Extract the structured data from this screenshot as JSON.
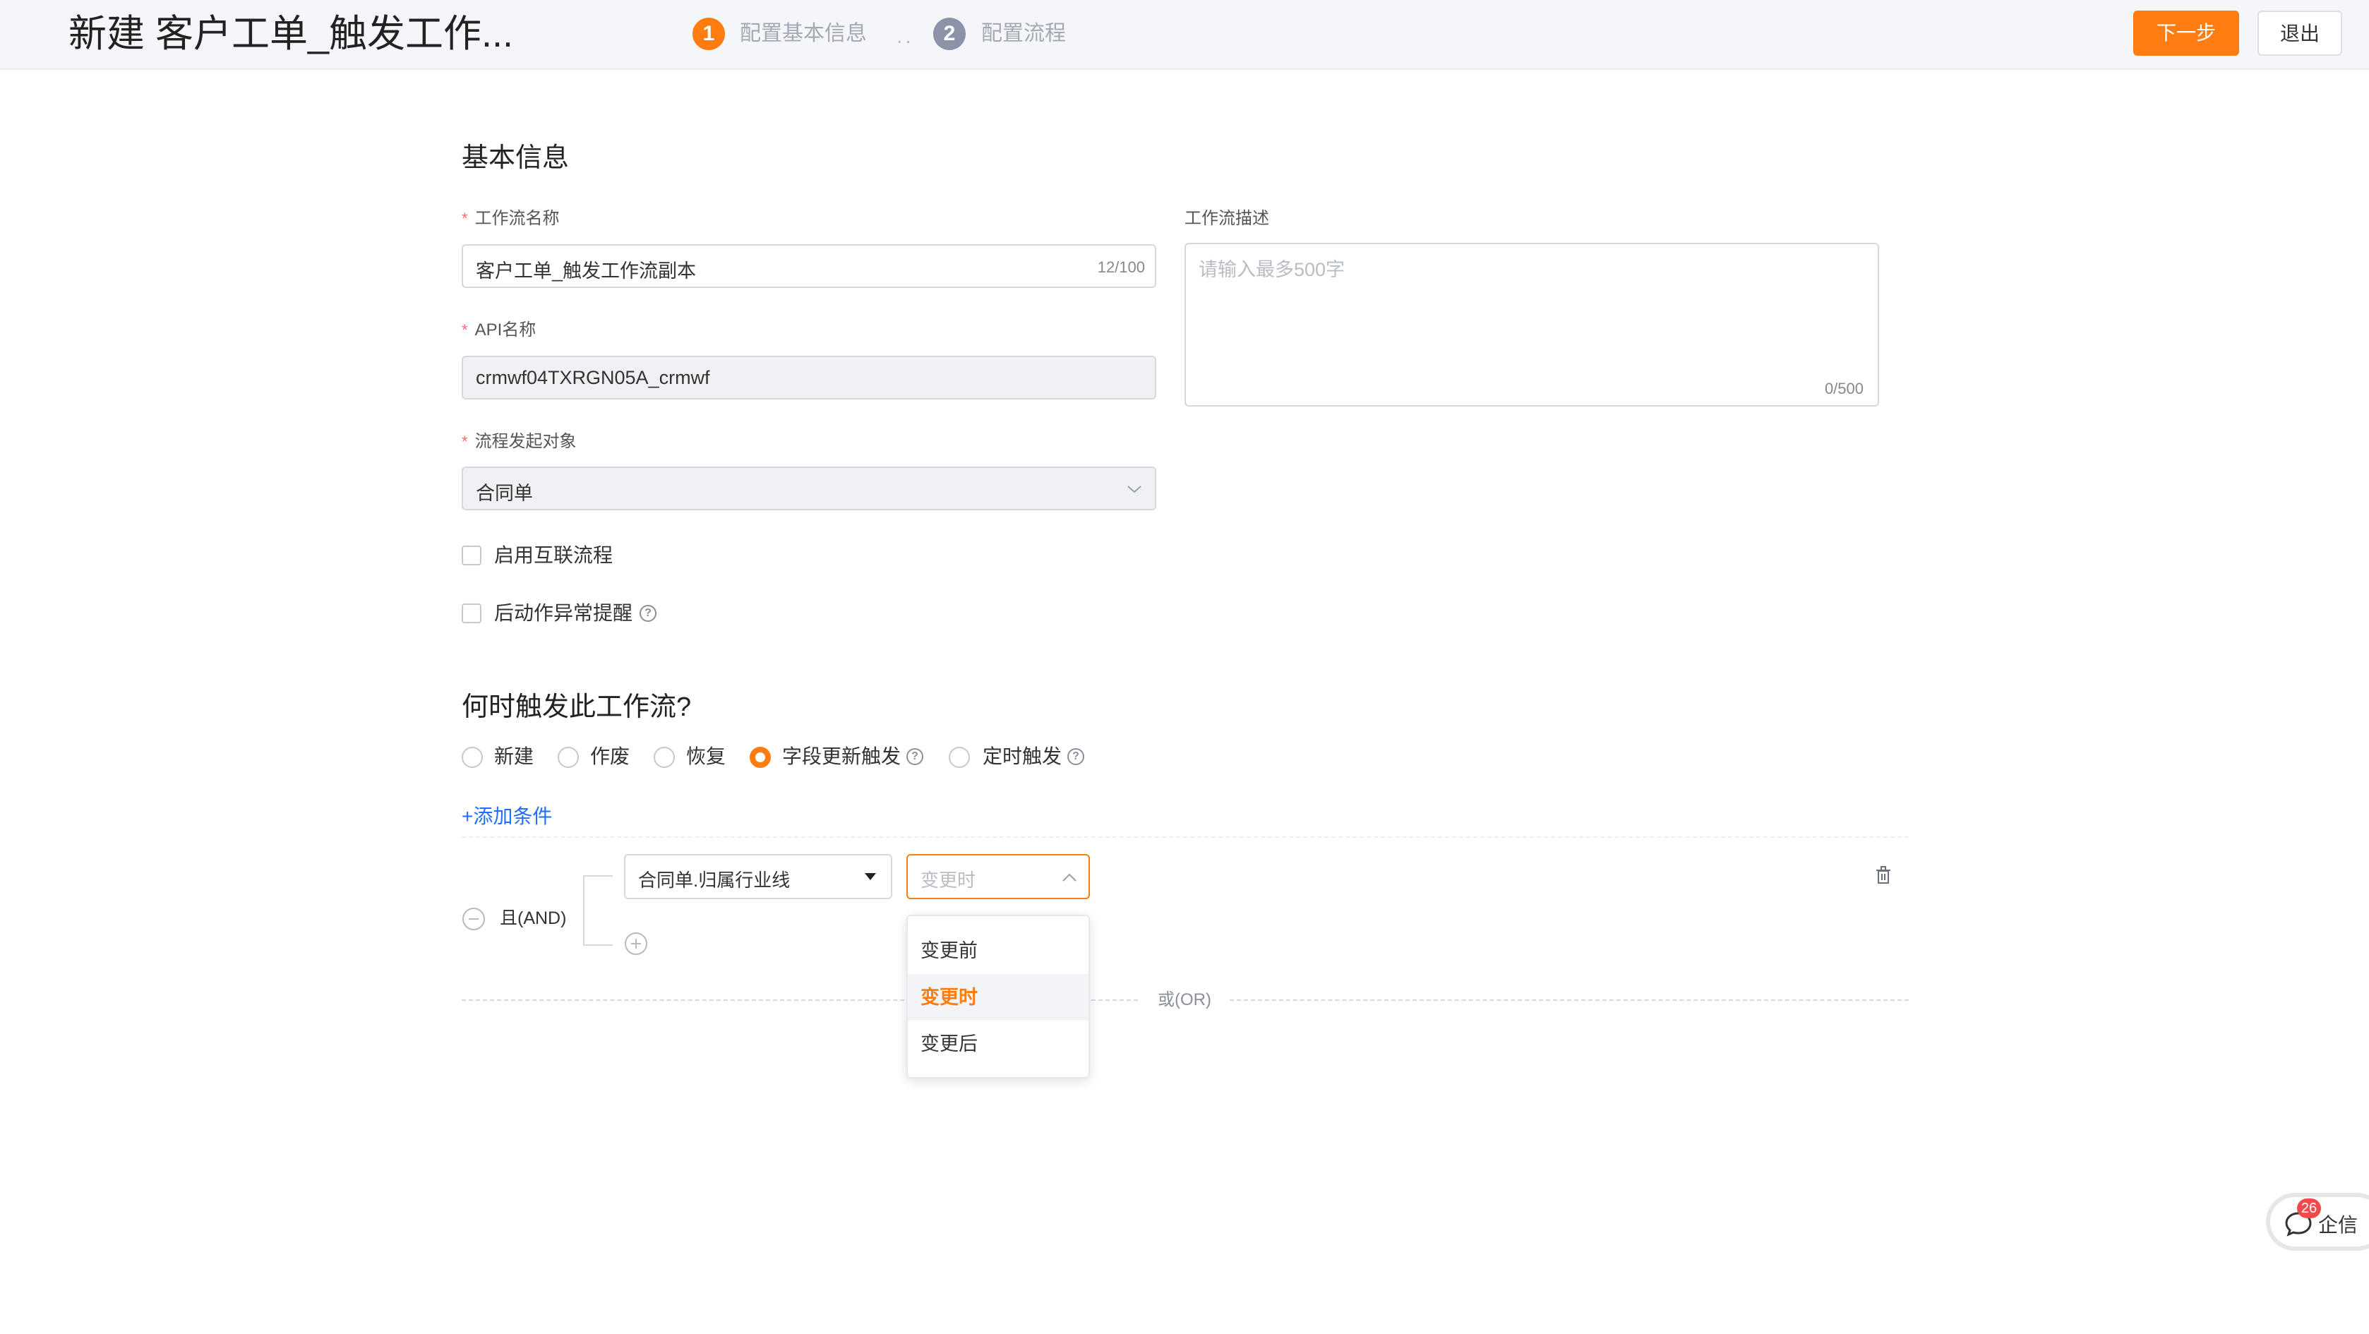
{
  "header": {
    "title": "新建 客户工单_触发工作...",
    "steps": [
      {
        "number": "1",
        "label": "配置基本信息",
        "color": "#ff7d10"
      },
      {
        "number": "2",
        "label": "配置流程",
        "color": "#8c93a8"
      }
    ],
    "step_separator": "..",
    "next_label": "下一步",
    "exit_label": "退出"
  },
  "basic": {
    "section_title": "基本信息",
    "name_label": "工作流名称",
    "name_value": "客户工单_触发工作流副本",
    "name_counter": "12/100",
    "api_label": "API名称",
    "api_value": "crmwf04TXRGN05A_crmwf",
    "object_label": "流程发起对象",
    "object_value": "合同单",
    "desc_label": "工作流描述",
    "desc_placeholder": "请输入最多500字",
    "desc_counter": "0/500",
    "checkbox_interlink": "启用互联流程",
    "checkbox_alert": "后动作异常提醒"
  },
  "trigger": {
    "section_title": "何时触发此工作流?",
    "options": [
      "新建",
      "作废",
      "恢复",
      "字段更新触发",
      "定时触发"
    ],
    "selected": "字段更新触发",
    "add_condition": "+添加条件",
    "and_label": "且(AND)",
    "or_label": "或(OR)",
    "condition_field": "合同单.归属行业线",
    "condition_operator_placeholder": "变更时",
    "dropdown_options": [
      "变更前",
      "变更时",
      "变更后"
    ],
    "dropdown_active": "变更时"
  },
  "chat": {
    "badge": "26",
    "label": "企信"
  }
}
